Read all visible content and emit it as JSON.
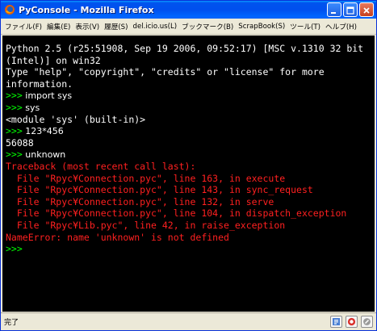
{
  "window": {
    "title": "PyConsole - Mozilla Firefox"
  },
  "menubar": {
    "items": [
      {
        "label": "ファイル(F)"
      },
      {
        "label": "編集(E)"
      },
      {
        "label": "表示(V)"
      },
      {
        "label": "履歴(S)"
      },
      {
        "label": "del.icio.us(L)"
      },
      {
        "label": "ブックマーク(B)"
      },
      {
        "label": "ScrapBook(S)"
      },
      {
        "label": "ツール(T)"
      },
      {
        "label": "ヘルプ(H)"
      }
    ]
  },
  "console": {
    "banner": [
      "Python 2.5 (r25:51908, Sep 19 2006, 09:52:17) [MSC v.1310 32 bit",
      "(Intel)] on win32",
      "Type \"help\", \"copyright\", \"credits\" or \"license\" for more",
      "information."
    ],
    "prompt": ">>>",
    "entries": [
      {
        "command": " import sys",
        "output": []
      },
      {
        "command": " sys",
        "output": [
          "<module 'sys' (built-in)>"
        ]
      },
      {
        "command": " 123*456",
        "output": [
          "56088"
        ]
      }
    ],
    "error_entry": {
      "command": " unknown",
      "traceback": [
        "Traceback (most recent call last):",
        "  File \"Rpyc¥Connection.pyc\", line 163, in execute",
        "  File \"Rpyc¥Connection.pyc\", line 143, in sync_request",
        "  File \"Rpyc¥Connection.pyc\", line 132, in serve",
        "  File \"Rpyc¥Connection.pyc\", line 104, in dispatch_exception",
        "  File \"Rpyc¥Lib.pyc\", line 42, in raise_exception",
        "NameError: name 'unknown' is not defined"
      ]
    },
    "final_prompt": ">>>"
  },
  "statusbar": {
    "text": "完了"
  },
  "colors": {
    "prompt": "#00ff00",
    "output": "#ffffff",
    "error": "#ff2020",
    "background": "#000000"
  }
}
